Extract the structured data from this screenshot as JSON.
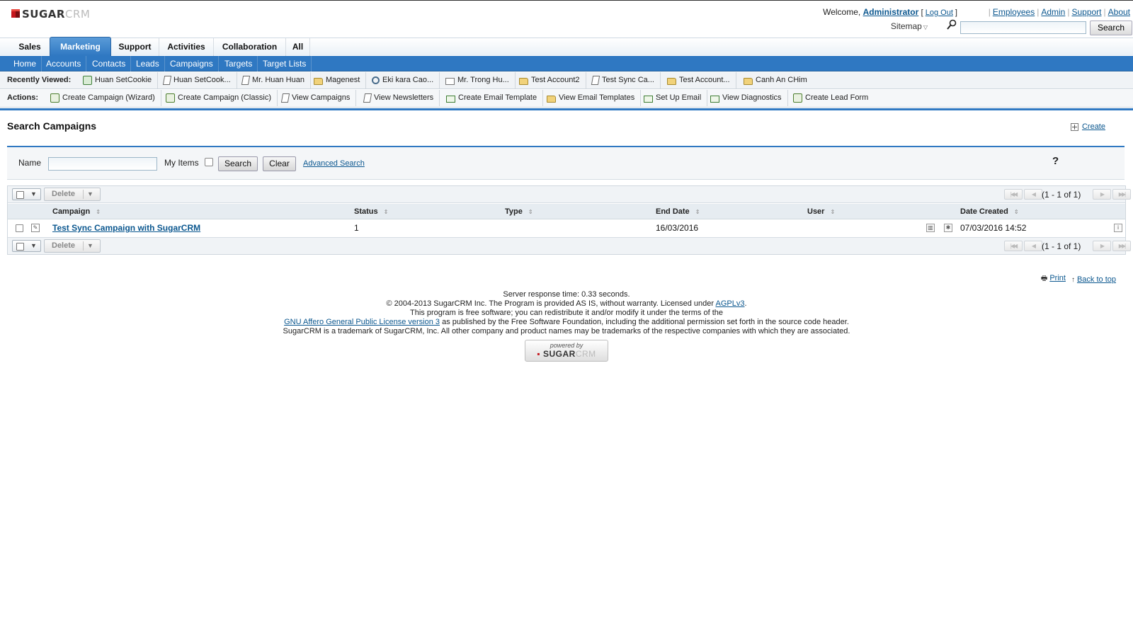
{
  "header": {
    "logo_main": "SUGAR",
    "logo_light": "CRM",
    "welcome_prefix": "Welcome,",
    "user": "Administrator",
    "logout": "Log Out",
    "links": [
      "Employees",
      "Admin",
      "Support",
      "About"
    ],
    "sitemap": "Sitemap",
    "search_button": "Search",
    "search_value": ""
  },
  "module_tabs": [
    {
      "label": "Sales",
      "active": false
    },
    {
      "label": "Marketing",
      "active": true
    },
    {
      "label": "Support",
      "active": false
    },
    {
      "label": "Activities",
      "active": false
    },
    {
      "label": "Collaboration",
      "active": false
    },
    {
      "label": "All",
      "active": false
    }
  ],
  "sub_tabs": [
    "Home",
    "Accounts",
    "Contacts",
    "Leads",
    "Campaigns",
    "Targets",
    "Target Lists"
  ],
  "recently_viewed": {
    "label": "Recently Viewed:",
    "items": [
      {
        "label": "Huan SetCookie",
        "icon": "money-icon"
      },
      {
        "label": "Huan SetCook...",
        "icon": "document-icon"
      },
      {
        "label": "Mr. Huan Huan",
        "icon": "document-icon"
      },
      {
        "label": "Magenest",
        "icon": "folder-icon"
      },
      {
        "label": "Eki kara Cao...",
        "icon": "magnifier-icon"
      },
      {
        "label": "Mr. Trong Hu...",
        "icon": "card-icon"
      },
      {
        "label": "Test Account2",
        "icon": "folder-icon"
      },
      {
        "label": "Test Sync Ca...",
        "icon": "document-icon"
      },
      {
        "label": "Test Account...",
        "icon": "folder-icon"
      },
      {
        "label": "Canh An CHim",
        "icon": "folder-icon"
      }
    ]
  },
  "actions": {
    "label": "Actions:",
    "items": [
      {
        "label": "Create Campaign (Wizard)",
        "icon": "campaign-wizard-icon"
      },
      {
        "label": "Create Campaign (Classic)",
        "icon": "campaign-classic-icon"
      },
      {
        "label": "View Campaigns",
        "icon": "campaign-icon"
      },
      {
        "label": "View Newsletters",
        "icon": "newsletter-icon"
      },
      {
        "label": "Create Email Template",
        "icon": "email-template-icon"
      },
      {
        "label": "View Email Templates",
        "icon": "email-templates-icon"
      },
      {
        "label": "Set Up Email",
        "icon": "email-setup-icon"
      },
      {
        "label": "View Diagnostics",
        "icon": "diagnostics-icon"
      },
      {
        "label": "Create Lead Form",
        "icon": "lead-form-icon"
      }
    ]
  },
  "page": {
    "title": "Search Campaigns",
    "create": "Create"
  },
  "search_form": {
    "name_label": "Name",
    "name_value": "",
    "my_items_label": "My Items",
    "my_items_checked": false,
    "search_button": "Search",
    "clear_button": "Clear",
    "advanced": "Advanced Search",
    "help": "?"
  },
  "list": {
    "delete_label": "Delete",
    "pagination_top": "(1 - 1 of 1)",
    "pagination_bottom": "(1 - 1 of 1)",
    "columns": [
      "Campaign",
      "Status",
      "Type",
      "End Date",
      "User",
      "Date Created"
    ],
    "rows": [
      {
        "campaign": "Test Sync Campaign with SugarCRM",
        "status": "1",
        "type": "",
        "end_date": "16/03/2016",
        "user": "",
        "date_created": "07/03/2016 14:52"
      }
    ]
  },
  "footer": {
    "print": "Print",
    "back_to_top": "Back to top",
    "response_time": "Server response time: 0.33 seconds.",
    "copyright_pre": "© 2004-2013 SugarCRM Inc. The Program is provided AS IS, without warranty. Licensed under",
    "agpl": "AGPLv3",
    "free_software": "This program is free software; you can redistribute it and/or modify it under the terms of the",
    "gnu_link": "GNU Affero General Public License version 3",
    "gnu_post": "as published by the Free Software Foundation, including the additional permission set forth in the source code header.",
    "trademark": "SugarCRM is a trademark of SugarCRM, Inc. All other company and product names may be trademarks of the respective companies with which they are associated.",
    "powered_by": "powered by",
    "powered_main": "SUGAR",
    "powered_light": "CRM"
  }
}
